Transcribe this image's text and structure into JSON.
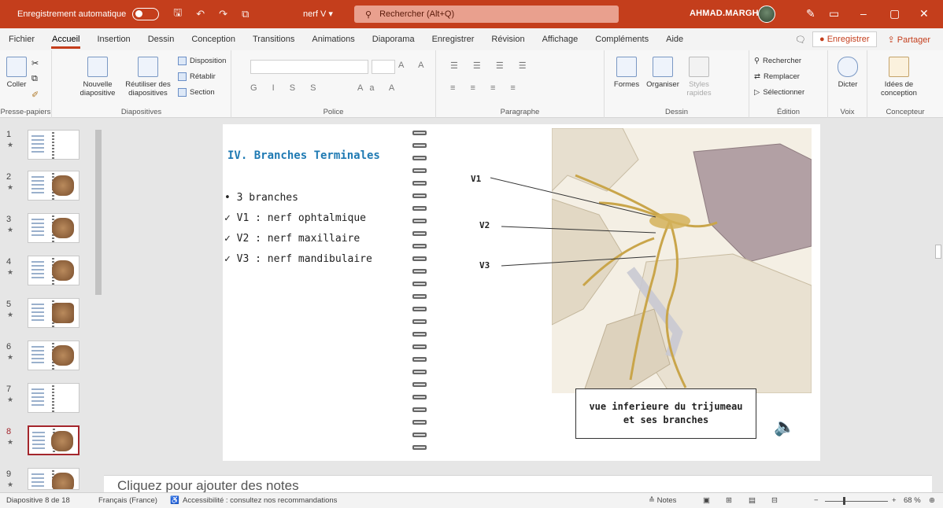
{
  "titlebar": {
    "autosave_label": "Enregistrement automatique",
    "file_name": "nerf V ▾",
    "search_placeholder": "Rechercher (Alt+Q)",
    "user_name": "AHMAD.MARGHADI"
  },
  "menu": {
    "tabs": [
      "Fichier",
      "Accueil",
      "Insertion",
      "Dessin",
      "Conception",
      "Transitions",
      "Animations",
      "Diaporama",
      "Enregistrer",
      "Révision",
      "Affichage",
      "Compléments",
      "Aide"
    ],
    "active_tab": "Accueil",
    "record_label": "Enregistrer",
    "share_label": "Partager"
  },
  "ribbon": {
    "clipboard": {
      "paste": "Coller",
      "group": "Presse-papiers"
    },
    "slides": {
      "new": "Nouvelle diapositive",
      "reuse": "Réutiliser des diapositives",
      "layout": "Disposition",
      "reset": "Rétablir",
      "section": "Section",
      "group": "Diapositives"
    },
    "font": {
      "group": "Police"
    },
    "paragraph": {
      "group": "Paragraphe"
    },
    "drawing": {
      "shapes": "Formes",
      "arrange": "Organiser",
      "styles": "Styles rapides",
      "group": "Dessin"
    },
    "editing": {
      "find": "Rechercher",
      "replace": "Remplacer",
      "select": "Sélectionner",
      "group": "Édition"
    },
    "voice": {
      "dictate": "Dicter",
      "group": "Voix"
    },
    "designer": {
      "ideas": "Idées de conception",
      "group": "Concepteur"
    }
  },
  "thumbnails": [
    {
      "num": "1"
    },
    {
      "num": "2"
    },
    {
      "num": "3"
    },
    {
      "num": "4"
    },
    {
      "num": "5"
    },
    {
      "num": "6"
    },
    {
      "num": "7"
    },
    {
      "num": "8",
      "selected": true
    },
    {
      "num": "9"
    }
  ],
  "slide": {
    "title": "IV. Branches Terminales",
    "bullets": [
      "•  3 branches",
      "✓ V1 : nerf ophtalmique",
      "✓ V2 : nerf maxillaire",
      "✓ V3 : nerf mandibulaire"
    ],
    "labels": {
      "v1": "V1",
      "v2": "V2",
      "v3": "V3"
    },
    "caption_line1": "vue inferieure du trijumeau",
    "caption_line2": "et ses branches"
  },
  "notes_placeholder": "Cliquez pour ajouter des notes",
  "status": {
    "slide_info": "Diapositive 8 de 18",
    "language": "Français (France)",
    "accessibility": "Accessibilité : consultez nos recommandations",
    "notes_btn": "Notes",
    "zoom": "68 %"
  },
  "colors": {
    "accent": "#c43e1c",
    "title_blue": "#1f7ab3"
  }
}
